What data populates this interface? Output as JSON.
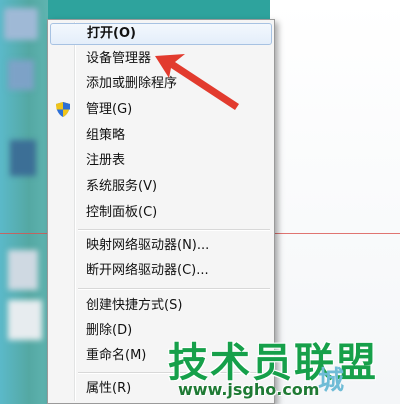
{
  "context_menu": {
    "items": [
      {
        "label": "打开(O)"
      },
      {
        "label": "设备管理器"
      },
      {
        "label": "添加或删除程序"
      },
      {
        "label": "管理(G)"
      },
      {
        "label": "组策略"
      },
      {
        "label": "注册表"
      },
      {
        "label": "系统服务(V)"
      },
      {
        "label": "控制面板(C)"
      },
      {
        "label": "映射网络驱动器(N)..."
      },
      {
        "label": "断开网络驱动器(C)..."
      },
      {
        "label": "创建快捷方式(S)"
      },
      {
        "label": "删除(D)"
      },
      {
        "label": "重命名(M)"
      },
      {
        "label": "属性(R)"
      }
    ]
  },
  "watermark": {
    "brand": "技术员联盟",
    "url": "www.jsgho.com",
    "tail": "城"
  },
  "colors": {
    "arrow": "#e23b2e",
    "watermark": "#16a04a",
    "menu_bg": "#f5f5f5"
  }
}
